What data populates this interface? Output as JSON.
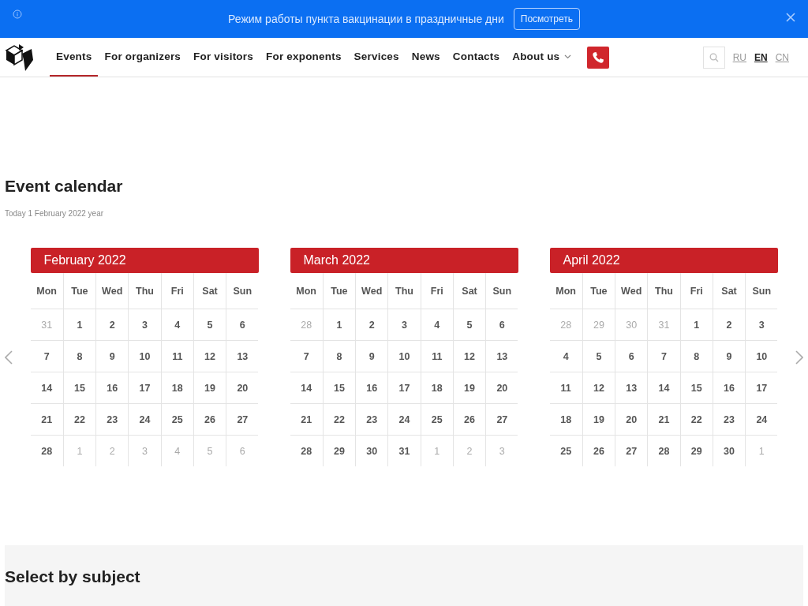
{
  "banner": {
    "message": "Режим работы пункта вакцинации в праздничные дни",
    "button": "Посмотреть"
  },
  "nav": {
    "items": [
      {
        "label": "Events",
        "selected": true
      },
      {
        "label": "For organizers",
        "selected": false
      },
      {
        "label": "For visitors",
        "selected": false
      },
      {
        "label": "For exponents",
        "selected": false
      },
      {
        "label": "Services",
        "selected": false
      },
      {
        "label": "News",
        "selected": false
      },
      {
        "label": "Contacts",
        "selected": false
      },
      {
        "label": "About us",
        "selected": false,
        "dropdown": true
      }
    ],
    "languages": [
      {
        "label": "RU",
        "selected": false
      },
      {
        "label": "EN",
        "selected": true
      },
      {
        "label": "CN",
        "selected": false
      }
    ]
  },
  "heading": "Event calendar",
  "today": "Today 1 February 2022 year",
  "calendars": [
    {
      "title": "February 2022",
      "weekdays": [
        "Mon",
        "Tue",
        "Wed",
        "Thu",
        "Fri",
        "Sat",
        "Sun"
      ],
      "weeks": [
        [
          {
            "day": "31",
            "muted": true
          },
          {
            "day": "1",
            "muted": false
          },
          {
            "day": "2",
            "muted": false
          },
          {
            "day": "3",
            "muted": false
          },
          {
            "day": "4",
            "muted": false
          },
          {
            "day": "5",
            "muted": false
          },
          {
            "day": "6",
            "muted": false
          }
        ],
        [
          {
            "day": "7",
            "muted": false
          },
          {
            "day": "8",
            "muted": false
          },
          {
            "day": "9",
            "muted": false
          },
          {
            "day": "10",
            "muted": false
          },
          {
            "day": "11",
            "muted": false
          },
          {
            "day": "12",
            "muted": false
          },
          {
            "day": "13",
            "muted": false
          }
        ],
        [
          {
            "day": "14",
            "muted": false
          },
          {
            "day": "15",
            "muted": false
          },
          {
            "day": "16",
            "muted": false
          },
          {
            "day": "17",
            "muted": false
          },
          {
            "day": "18",
            "muted": false
          },
          {
            "day": "19",
            "muted": false
          },
          {
            "day": "20",
            "muted": false
          }
        ],
        [
          {
            "day": "21",
            "muted": false
          },
          {
            "day": "22",
            "muted": false
          },
          {
            "day": "23",
            "muted": false
          },
          {
            "day": "24",
            "muted": false
          },
          {
            "day": "25",
            "muted": false
          },
          {
            "day": "26",
            "muted": false
          },
          {
            "day": "27",
            "muted": false
          }
        ],
        [
          {
            "day": "28",
            "muted": false
          },
          {
            "day": "1",
            "muted": true
          },
          {
            "day": "2",
            "muted": true
          },
          {
            "day": "3",
            "muted": true
          },
          {
            "day": "4",
            "muted": true
          },
          {
            "day": "5",
            "muted": true
          },
          {
            "day": "6",
            "muted": true
          }
        ]
      ]
    },
    {
      "title": "March 2022",
      "weekdays": [
        "Mon",
        "Tue",
        "Wed",
        "Thu",
        "Fri",
        "Sat",
        "Sun"
      ],
      "weeks": [
        [
          {
            "day": "28",
            "muted": true
          },
          {
            "day": "1",
            "muted": false
          },
          {
            "day": "2",
            "muted": false
          },
          {
            "day": "3",
            "muted": false
          },
          {
            "day": "4",
            "muted": false
          },
          {
            "day": "5",
            "muted": false
          },
          {
            "day": "6",
            "muted": false
          }
        ],
        [
          {
            "day": "7",
            "muted": false
          },
          {
            "day": "8",
            "muted": false
          },
          {
            "day": "9",
            "muted": false
          },
          {
            "day": "10",
            "muted": false
          },
          {
            "day": "11",
            "muted": false
          },
          {
            "day": "12",
            "muted": false
          },
          {
            "day": "13",
            "muted": false
          }
        ],
        [
          {
            "day": "14",
            "muted": false
          },
          {
            "day": "15",
            "muted": false
          },
          {
            "day": "16",
            "muted": false
          },
          {
            "day": "17",
            "muted": false
          },
          {
            "day": "18",
            "muted": false
          },
          {
            "day": "19",
            "muted": false
          },
          {
            "day": "20",
            "muted": false
          }
        ],
        [
          {
            "day": "21",
            "muted": false
          },
          {
            "day": "22",
            "muted": false
          },
          {
            "day": "23",
            "muted": false
          },
          {
            "day": "24",
            "muted": false
          },
          {
            "day": "25",
            "muted": false
          },
          {
            "day": "26",
            "muted": false
          },
          {
            "day": "27",
            "muted": false
          }
        ],
        [
          {
            "day": "28",
            "muted": false
          },
          {
            "day": "29",
            "muted": false
          },
          {
            "day": "30",
            "muted": false
          },
          {
            "day": "31",
            "muted": false
          },
          {
            "day": "1",
            "muted": true
          },
          {
            "day": "2",
            "muted": true
          },
          {
            "day": "3",
            "muted": true
          }
        ]
      ]
    },
    {
      "title": "April 2022",
      "weekdays": [
        "Mon",
        "Tue",
        "Wed",
        "Thu",
        "Fri",
        "Sat",
        "Sun"
      ],
      "weeks": [
        [
          {
            "day": "28",
            "muted": true
          },
          {
            "day": "29",
            "muted": true
          },
          {
            "day": "30",
            "muted": true
          },
          {
            "day": "31",
            "muted": true
          },
          {
            "day": "1",
            "muted": false
          },
          {
            "day": "2",
            "muted": false
          },
          {
            "day": "3",
            "muted": false
          }
        ],
        [
          {
            "day": "4",
            "muted": false
          },
          {
            "day": "5",
            "muted": false
          },
          {
            "day": "6",
            "muted": false
          },
          {
            "day": "7",
            "muted": false
          },
          {
            "day": "8",
            "muted": false
          },
          {
            "day": "9",
            "muted": false
          },
          {
            "day": "10",
            "muted": false
          }
        ],
        [
          {
            "day": "11",
            "muted": false
          },
          {
            "day": "12",
            "muted": false
          },
          {
            "day": "13",
            "muted": false
          },
          {
            "day": "14",
            "muted": false
          },
          {
            "day": "15",
            "muted": false
          },
          {
            "day": "16",
            "muted": false
          },
          {
            "day": "17",
            "muted": false
          }
        ],
        [
          {
            "day": "18",
            "muted": false
          },
          {
            "day": "19",
            "muted": false
          },
          {
            "day": "20",
            "muted": false
          },
          {
            "day": "21",
            "muted": false
          },
          {
            "day": "22",
            "muted": false
          },
          {
            "day": "23",
            "muted": false
          },
          {
            "day": "24",
            "muted": false
          }
        ],
        [
          {
            "day": "25",
            "muted": false
          },
          {
            "day": "26",
            "muted": false
          },
          {
            "day": "27",
            "muted": false
          },
          {
            "day": "28",
            "muted": false
          },
          {
            "day": "29",
            "muted": false
          },
          {
            "day": "30",
            "muted": false
          },
          {
            "day": "1",
            "muted": true
          }
        ]
      ]
    }
  ],
  "subject_section": {
    "title": "Select by subject"
  }
}
